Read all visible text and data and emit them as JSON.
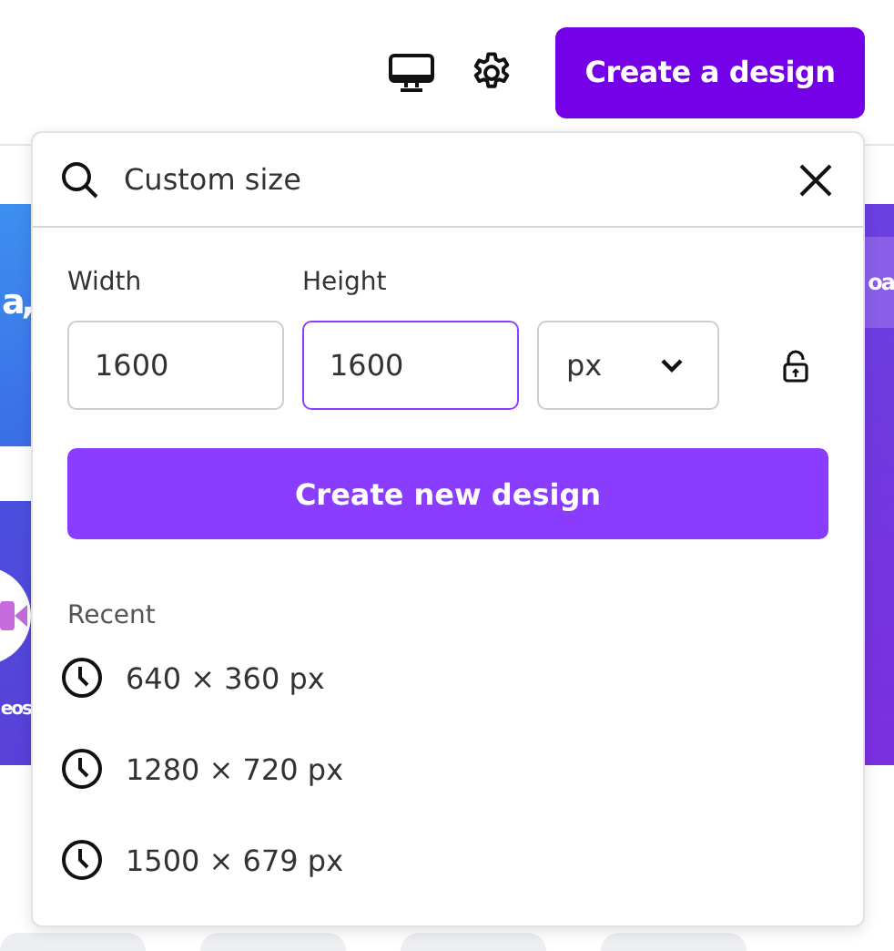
{
  "header": {
    "create_button": "Create a design"
  },
  "background": {
    "left_cards": [
      {
        "kind": "text",
        "text": "a,"
      },
      {
        "kind": "video",
        "text": "eos"
      }
    ],
    "right_card": {
      "text": "oa"
    }
  },
  "size_menu": {
    "search": {
      "value": "Custom size"
    },
    "fields": [
      {
        "label": "Width",
        "value": "1600",
        "focused": false
      },
      {
        "label": "Height",
        "value": "1600",
        "focused": true
      }
    ],
    "unit": "px",
    "locked": false,
    "create_button": "Create new design",
    "recent": {
      "title": "Recent",
      "items": [
        "640 × 360 px",
        "1280 × 720 px",
        "1500 × 679 px"
      ]
    }
  }
}
